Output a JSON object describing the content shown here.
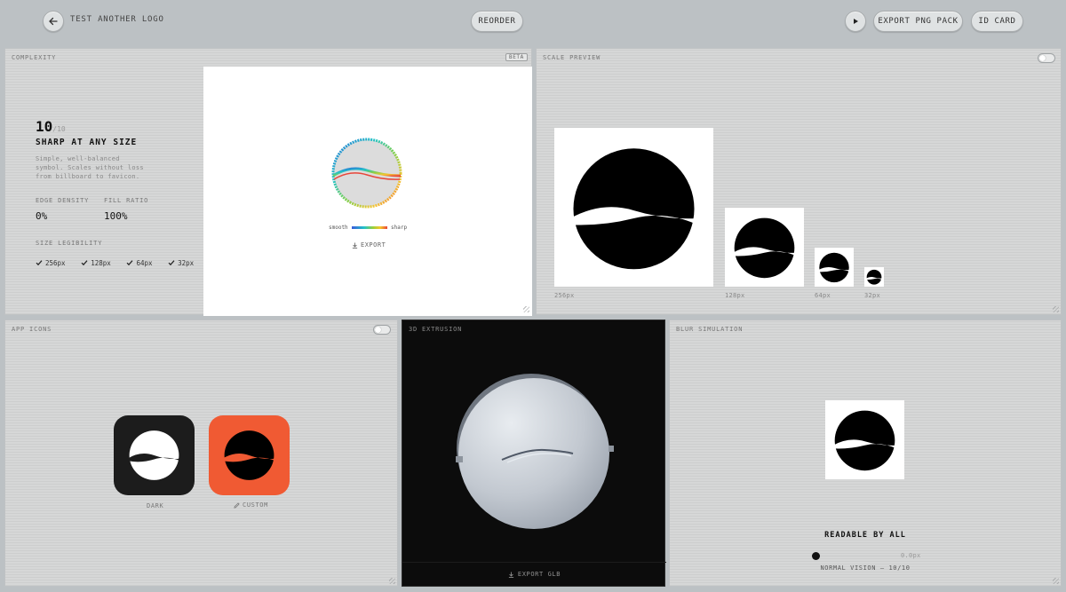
{
  "topbar": {
    "back_icon": "arrow-left-icon",
    "brand": "TEST ANOTHER LOGO",
    "reorder": "REORDER",
    "play_icon": "play-icon",
    "export_png": "EXPORT PNG PACK",
    "id_card": "ID CARD"
  },
  "complexity": {
    "title": "COMPLEXITY",
    "badge": "BETA",
    "score": "10",
    "score_max": "/10",
    "headline": "SHARP AT ANY SIZE",
    "description_lines": [
      "Simple, well-balanced",
      "symbol. Scales without loss",
      "from billboard to favicon."
    ],
    "edge_density_label": "EDGE DENSITY",
    "edge_density_value": "0%",
    "fill_ratio_label": "FILL RATIO",
    "fill_ratio_value": "100%",
    "legibility_label": "SIZE LEGIBILITY",
    "sizes": [
      "256px",
      "128px",
      "64px",
      "32px"
    ],
    "legend_smooth": "smooth",
    "legend_sharp": "sharp",
    "export": "EXPORT"
  },
  "scale_preview": {
    "title": "SCALE PREVIEW",
    "labels": [
      "256px",
      "128px",
      "64px",
      "32px"
    ]
  },
  "app_icons": {
    "title": "APP ICONS",
    "dark_label": "DARK",
    "custom_label": "CUSTOM",
    "custom_color": "#f05a33"
  },
  "extrusion": {
    "title": "3D EXTRUSION",
    "export": "EXPORT GLB"
  },
  "blur": {
    "title": "BLUR SIMULATION",
    "headline": "READABLE BY ALL",
    "slider_value": "0.0px",
    "slider_level": 0,
    "status": "NORMAL VISION — 10/10"
  }
}
